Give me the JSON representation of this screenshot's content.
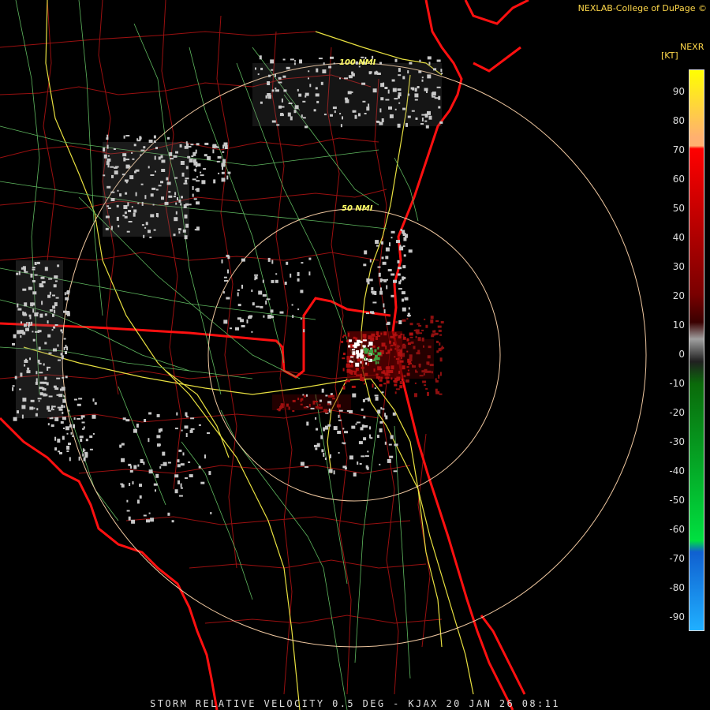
{
  "header": {
    "credit": "NEXLAB-College of DuPage ©"
  },
  "legend": {
    "product_code": "NEXR",
    "unit": "[KT]",
    "ticks": [
      "90",
      "80",
      "70",
      "60",
      "50",
      "40",
      "30",
      "20",
      "10",
      "0",
      "-10",
      "-20",
      "-30",
      "-40",
      "-50",
      "-60",
      "-70",
      "-80",
      "-90"
    ],
    "colors": {
      "yellow": "#ffff00",
      "orange": "#ffb070",
      "red": "#ff0000",
      "dark_red": "#7a0000",
      "gray": "#a0a0a0",
      "dark_green": "#0a6a0a",
      "green": "#00e040",
      "blue": "#1060d0",
      "light_blue": "#20b0ff"
    }
  },
  "range_rings": {
    "inner_label": "50 NMI",
    "outer_label": "100 NMI"
  },
  "footer": {
    "caption": "STORM RELATIVE VELOCITY 0.5 DEG - KJAX 20 JAN 26 08:11"
  }
}
